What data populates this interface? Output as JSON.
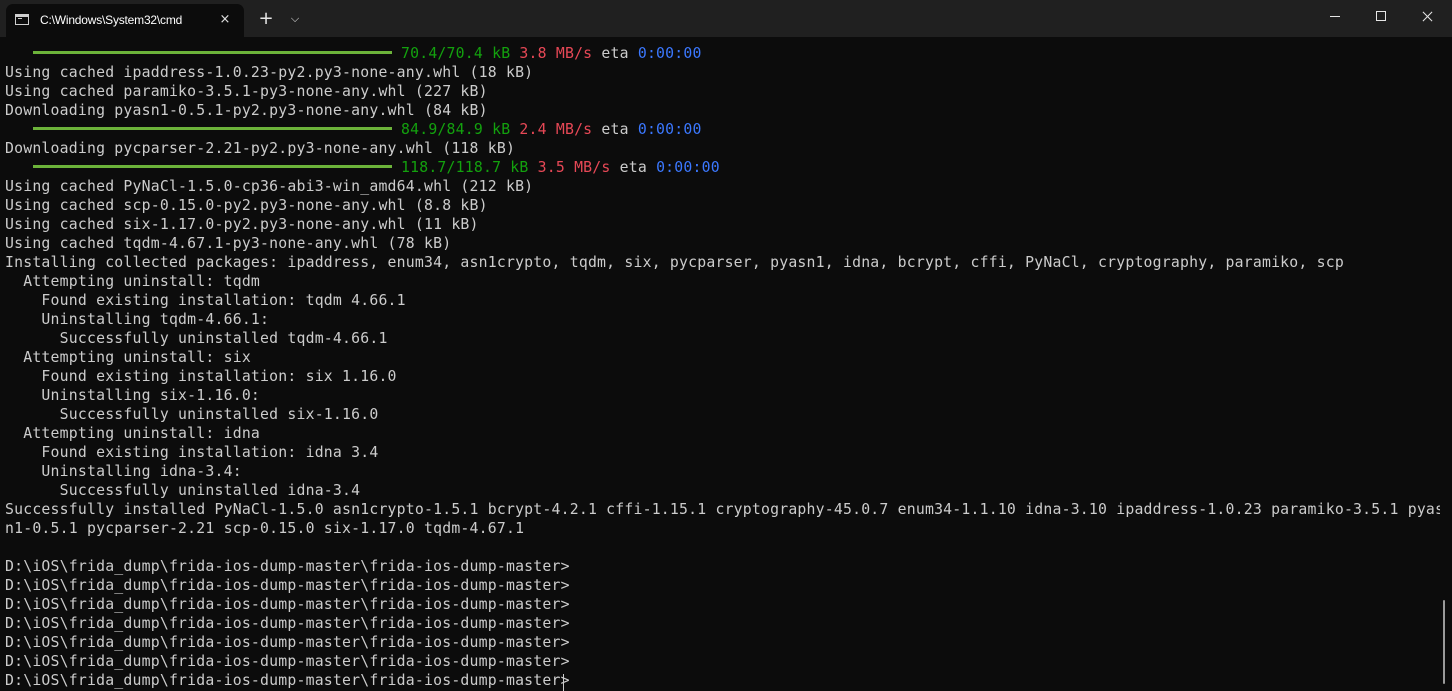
{
  "window": {
    "tab_title": "C:\\Windows\\System32\\cmd",
    "tab_close_icon": "×",
    "new_tab_icon": "+",
    "dropdown_icon": "⌵"
  },
  "colors": {
    "background": "#0c0c0c",
    "titlebar": "#202020",
    "text": "#cccccc",
    "progress_bar": "#6cb33a",
    "size": "#13a10e",
    "speed": "#e74856",
    "eta": "#3b78ff"
  },
  "progress": [
    {
      "size": "70.4/70.4 kB",
      "speed": "3.8 MB/s",
      "eta_label": "eta",
      "eta": "0:00:00",
      "fraction": 1.0
    },
    {
      "size": "84.9/84.9 kB",
      "speed": "2.4 MB/s",
      "eta_label": "eta",
      "eta": "0:00:00",
      "fraction": 1.0
    },
    {
      "size": "118.7/118.7 kB",
      "speed": "3.5 MB/s",
      "eta_label": "eta",
      "eta": "0:00:00",
      "fraction": 1.0
    }
  ],
  "lines": [
    "Using cached ipaddress-1.0.23-py2.py3-none-any.whl (18 kB)",
    "Using cached paramiko-3.5.1-py3-none-any.whl (227 kB)",
    "Downloading pyasn1-0.5.1-py2.py3-none-any.whl (84 kB)",
    "Downloading pycparser-2.21-py2.py3-none-any.whl (118 kB)",
    "Using cached PyNaCl-1.5.0-cp36-abi3-win_amd64.whl (212 kB)",
    "Using cached scp-0.15.0-py2.py3-none-any.whl (8.8 kB)",
    "Using cached six-1.17.0-py2.py3-none-any.whl (11 kB)",
    "Using cached tqdm-4.67.1-py3-none-any.whl (78 kB)",
    "Installing collected packages: ipaddress, enum34, asn1crypto, tqdm, six, pycparser, pyasn1, idna, bcrypt, cffi, PyNaCl, cryptography, paramiko, scp",
    "  Attempting uninstall: tqdm",
    "    Found existing installation: tqdm 4.66.1",
    "    Uninstalling tqdm-4.66.1:",
    "      Successfully uninstalled tqdm-4.66.1",
    "  Attempting uninstall: six",
    "    Found existing installation: six 1.16.0",
    "    Uninstalling six-1.16.0:",
    "      Successfully uninstalled six-1.16.0",
    "  Attempting uninstall: idna",
    "    Found existing installation: idna 3.4",
    "    Uninstalling idna-3.4:",
    "      Successfully uninstalled idna-3.4",
    "Successfully installed PyNaCl-1.5.0 asn1crypto-1.5.1 bcrypt-4.2.1 cffi-1.15.1 cryptography-45.0.7 enum34-1.1.10 idna-3.10 ipaddress-1.0.23 paramiko-3.5.1 pyas",
    "n1-0.5.1 pycparser-2.21 scp-0.15.0 six-1.17.0 tqdm-4.67.1",
    "",
    "D:\\iOS\\frida_dump\\frida-ios-dump-master\\frida-ios-dump-master>",
    "D:\\iOS\\frida_dump\\frida-ios-dump-master\\frida-ios-dump-master>",
    "D:\\iOS\\frida_dump\\frida-ios-dump-master\\frida-ios-dump-master>",
    "D:\\iOS\\frida_dump\\frida-ios-dump-master\\frida-ios-dump-master>",
    "D:\\iOS\\frida_dump\\frida-ios-dump-master\\frida-ios-dump-master>",
    "D:\\iOS\\frida_dump\\frida-ios-dump-master\\frida-ios-dump-master>",
    "D:\\iOS\\frida_dump\\frida-ios-dump-master\\frida-ios-dump-master>"
  ]
}
